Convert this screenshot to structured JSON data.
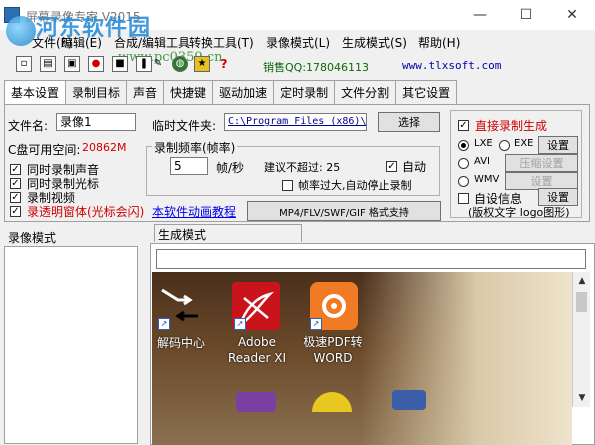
{
  "window": {
    "title": "屏幕录像专家 V2015",
    "minimize": "—",
    "maximize": "☐",
    "close": "✕"
  },
  "watermark": {
    "site_name": "河东软件园",
    "url": "www.pc0359.cn"
  },
  "menu": [
    {
      "label": "文件(F)"
    },
    {
      "label": "编辑(E)"
    },
    {
      "label": "合成/编辑工具"
    },
    {
      "label": "转换工具(T)"
    },
    {
      "label": "录像模式(L)"
    },
    {
      "label": "生成模式(S)"
    },
    {
      "label": "帮助(H)"
    }
  ],
  "toolbar": {
    "sales_qq": "销售QQ:178046113",
    "website": "www.tlxsoft.com",
    "icons": [
      "new-icon",
      "open-icon",
      "save-icon",
      "record-icon",
      "stop-icon",
      "pause-icon",
      "tool-icon",
      "globe-icon",
      "gift-icon",
      "help-icon"
    ]
  },
  "tabs": [
    "基本设置",
    "录制目标",
    "声音",
    "快捷键",
    "驱动加速",
    "定时录制",
    "文件分割",
    "其它设置"
  ],
  "basic": {
    "filename_label": "文件名:",
    "filename_value": "录像1",
    "temp_label": "临时文件夹:",
    "temp_value": "C:\\Program Files (x86)\\",
    "browse_button": "选择",
    "disk_space_label": "C盘可用空间:",
    "disk_space_value": "20862M",
    "rec_sound": "同时录制声音",
    "rec_cursor": "同时录制光标",
    "rec_video": "录制视频",
    "rec_transparent": "录透明窗体(光标会闪)",
    "anim_link": "本软件动画教程",
    "frame_group": "录制频率(帧率)",
    "fps_value": "5",
    "fps_unit": "帧/秒",
    "suggest_label": "建议不超过: 25",
    "auto_label": "自动",
    "auto_stop_label": "帧率过大,自动停止录制",
    "format_button": "MP4/FLV/SWF/GIF  格式支持"
  },
  "output": {
    "direct_label": "直接录制生成",
    "lxe": "LXE",
    "exe": "EXE",
    "setup1": "设置",
    "avi": "AVI",
    "compress": "压缩设置",
    "wmv": "WMV",
    "setup2": "设置",
    "custom_info": "自设信息",
    "setup3": "设置",
    "copyright": "(版权文字 logo图形)"
  },
  "panels": {
    "left_title": "录像模式",
    "right_title": "生成模式"
  },
  "desktop_icons": [
    {
      "label": "解码中心"
    },
    {
      "label": "Adobe\nReader XI"
    },
    {
      "label": "极速PDF转\nWORD"
    }
  ],
  "colors": {
    "accent_red": "#d00000",
    "link_blue": "#0000ee",
    "qq_green": "#0a6a0a"
  }
}
